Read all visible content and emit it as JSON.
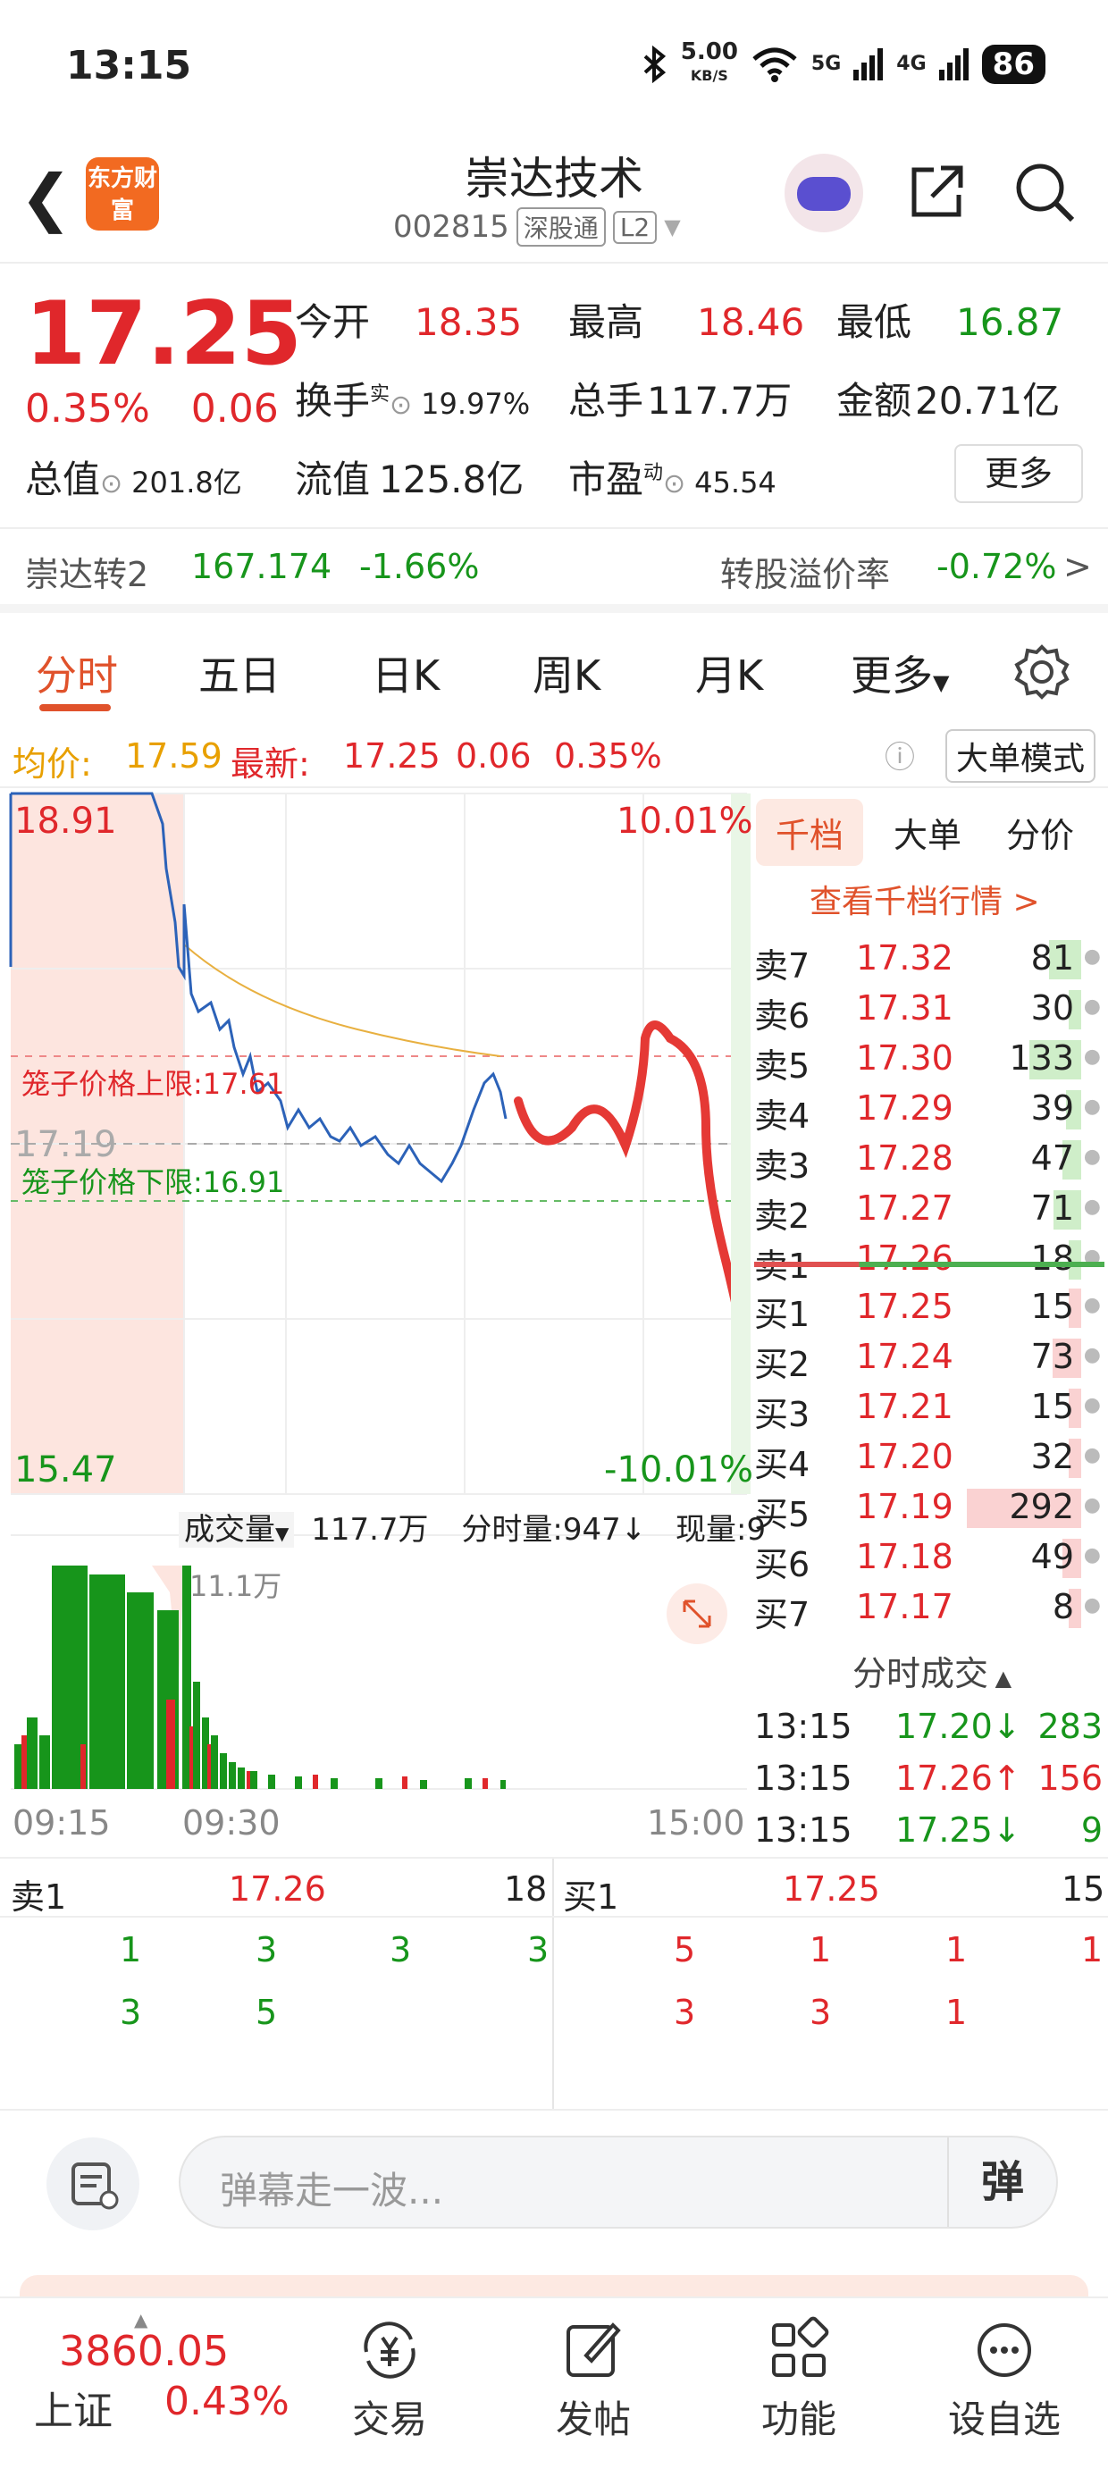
{
  "status": {
    "time": "13:15",
    "net_speed": "5.00",
    "net_unit": "KB/S",
    "sig1": "5G",
    "sig2": "4G",
    "battery": "86"
  },
  "header": {
    "title": "崇达技术",
    "code": "002815",
    "tag1": "深股通",
    "tag2": "L2",
    "logo": "东方财富"
  },
  "quote": {
    "price": "17.25",
    "pct": "0.35%",
    "change": "0.06",
    "open_label": "今开",
    "open": "18.35",
    "high_label": "最高",
    "high": "18.46",
    "low_label": "最低",
    "low": "16.87",
    "turnover_label": "换手",
    "turnover_sup": "实",
    "turnover": "19.97%",
    "vol_label": "总手",
    "vol": "117.7万",
    "amount_label": "金额",
    "amount": "20.71亿",
    "mcap_label": "总值",
    "mcap": "201.8亿",
    "float_label": "流值",
    "float": "125.8亿",
    "pe_label": "市盈",
    "pe_sup": "动",
    "pe": "45.54",
    "more": "更多"
  },
  "bond": {
    "name": "崇达转2",
    "price": "167.174",
    "pct": "-1.66%",
    "premium_label": "转股溢价率",
    "premium": "-0.72%"
  },
  "tabs": [
    "分时",
    "五日",
    "日K",
    "周K",
    "月K",
    "更多"
  ],
  "avg": {
    "avg_label": "均价:",
    "avg": "17.59",
    "last_label": "最新:",
    "last": "17.25",
    "chg": "0.06",
    "pct": "0.35%",
    "mode": "大单模式"
  },
  "chart": {
    "top_price": "18.91",
    "top_pct": "10.01%",
    "bottom_price": "15.47",
    "bottom_pct": "-10.01%",
    "mid_price": "17.19",
    "cage_up": "笼子价格上限:17.61",
    "cage_down": "笼子价格下限:16.91",
    "vol_label": "成交量",
    "vol_total": "117.7万",
    "fenshi_vol": "分时量:947↓",
    "xianliang": "现量:9",
    "vol_max": "11.1万",
    "t_start": "09:15",
    "t_mid": "09:30",
    "t_end": "15:00"
  },
  "side": {
    "tabs": [
      "千档",
      "大单",
      "分价"
    ],
    "link": "查看千档行情 >",
    "asks": [
      {
        "l": "卖7",
        "p": "17.32",
        "v": "81"
      },
      {
        "l": "卖6",
        "p": "17.31",
        "v": "30"
      },
      {
        "l": "卖5",
        "p": "17.30",
        "v": "133"
      },
      {
        "l": "卖4",
        "p": "17.29",
        "v": "39"
      },
      {
        "l": "卖3",
        "p": "17.28",
        "v": "47"
      },
      {
        "l": "卖2",
        "p": "17.27",
        "v": "71"
      },
      {
        "l": "卖1",
        "p": "17.26",
        "v": "18"
      }
    ],
    "bids": [
      {
        "l": "买1",
        "p": "17.25",
        "v": "15"
      },
      {
        "l": "买2",
        "p": "17.24",
        "v": "73"
      },
      {
        "l": "买3",
        "p": "17.21",
        "v": "15"
      },
      {
        "l": "买4",
        "p": "17.20",
        "v": "32"
      },
      {
        "l": "买5",
        "p": "17.19",
        "v": "292"
      },
      {
        "l": "买6",
        "p": "17.18",
        "v": "49"
      },
      {
        "l": "买7",
        "p": "17.17",
        "v": "8"
      }
    ],
    "trades_title": "分时成交",
    "trades": [
      {
        "t": "13:15",
        "p": "17.20↓",
        "v": "283"
      },
      {
        "t": "13:15",
        "p": "17.26↑",
        "v": "156"
      },
      {
        "t": "13:15",
        "p": "17.25↓",
        "v": "9"
      }
    ]
  },
  "ticks": {
    "sell_label": "卖1",
    "sell_price": "17.26",
    "sell_vol": "18",
    "buy_label": "买1",
    "buy_price": "17.25",
    "buy_vol": "15",
    "sell_row1": [
      "1",
      "3",
      "3",
      "3"
    ],
    "sell_row2": [
      "3",
      "5"
    ],
    "buy_row1": [
      "5",
      "1",
      "1",
      "1"
    ],
    "buy_row2": [
      "3",
      "3",
      "1"
    ]
  },
  "danmu": {
    "placeholder": "弹幕走一波...",
    "btn": "弹"
  },
  "bottom": {
    "index_value": "3860.05",
    "index_name": "上证",
    "index_pct": "0.43%",
    "items": [
      "交易",
      "发帖",
      "功能",
      "设自选"
    ]
  }
}
